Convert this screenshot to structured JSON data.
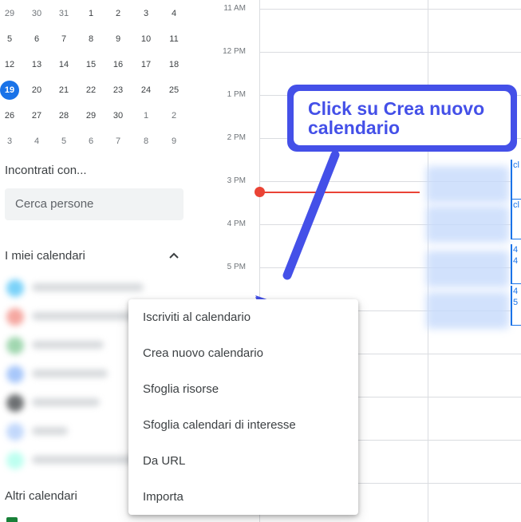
{
  "mini_calendar": {
    "weeks": [
      [
        {
          "d": "29",
          "dim": true
        },
        {
          "d": "30",
          "dim": true
        },
        {
          "d": "31",
          "dim": true
        },
        {
          "d": "1"
        },
        {
          "d": "2"
        },
        {
          "d": "3"
        },
        {
          "d": "4"
        }
      ],
      [
        {
          "d": "5"
        },
        {
          "d": "6"
        },
        {
          "d": "7"
        },
        {
          "d": "8"
        },
        {
          "d": "9"
        },
        {
          "d": "10"
        },
        {
          "d": "11"
        }
      ],
      [
        {
          "d": "12"
        },
        {
          "d": "13"
        },
        {
          "d": "14"
        },
        {
          "d": "15"
        },
        {
          "d": "16"
        },
        {
          "d": "17"
        },
        {
          "d": "18"
        }
      ],
      [
        {
          "d": "19",
          "today": true
        },
        {
          "d": "20"
        },
        {
          "d": "21"
        },
        {
          "d": "22"
        },
        {
          "d": "23"
        },
        {
          "d": "24"
        },
        {
          "d": "25"
        }
      ],
      [
        {
          "d": "26"
        },
        {
          "d": "27"
        },
        {
          "d": "28"
        },
        {
          "d": "29"
        },
        {
          "d": "30"
        },
        {
          "d": "1",
          "dim": true
        },
        {
          "d": "2",
          "dim": true
        }
      ],
      [
        {
          "d": "3",
          "dim": true
        },
        {
          "d": "4",
          "dim": true
        },
        {
          "d": "5",
          "dim": true
        },
        {
          "d": "6",
          "dim": true
        },
        {
          "d": "7",
          "dim": true
        },
        {
          "d": "8",
          "dim": true
        },
        {
          "d": "9",
          "dim": true
        }
      ]
    ],
    "today_color": "#1a73e8"
  },
  "sidebar": {
    "meet_title": "Incontrati con...",
    "search_placeholder": "Cerca persone",
    "my_calendars_title": "I miei calendari",
    "my_calendars_toggle_icon": "chevron-up-icon",
    "blurred_calendar_colors": [
      "#4fc3f7",
      "#f28b82",
      "#81c995",
      "#8ab4f8",
      "#3c4043",
      "#aecbfa",
      "#a7ffeb"
    ],
    "other_calendars_title": "Altri calendari"
  },
  "grid": {
    "time_labels": [
      "11 AM",
      "12 PM",
      "1 PM",
      "2 PM",
      "3 PM",
      "4 PM",
      "5 PM"
    ],
    "event_edge_texts": [
      "cl",
      "cl",
      "4\n4",
      "4\n5"
    ],
    "now_color": "#ea4335"
  },
  "callout": {
    "text": "Click su Crea nuovo calendario",
    "color": "#4450e8"
  },
  "menu": {
    "items": [
      "Iscriviti al calendario",
      "Crea nuovo calendario",
      "Sfoglia risorse",
      "Sfoglia calendari di interesse",
      "Da URL",
      "Importa"
    ]
  }
}
